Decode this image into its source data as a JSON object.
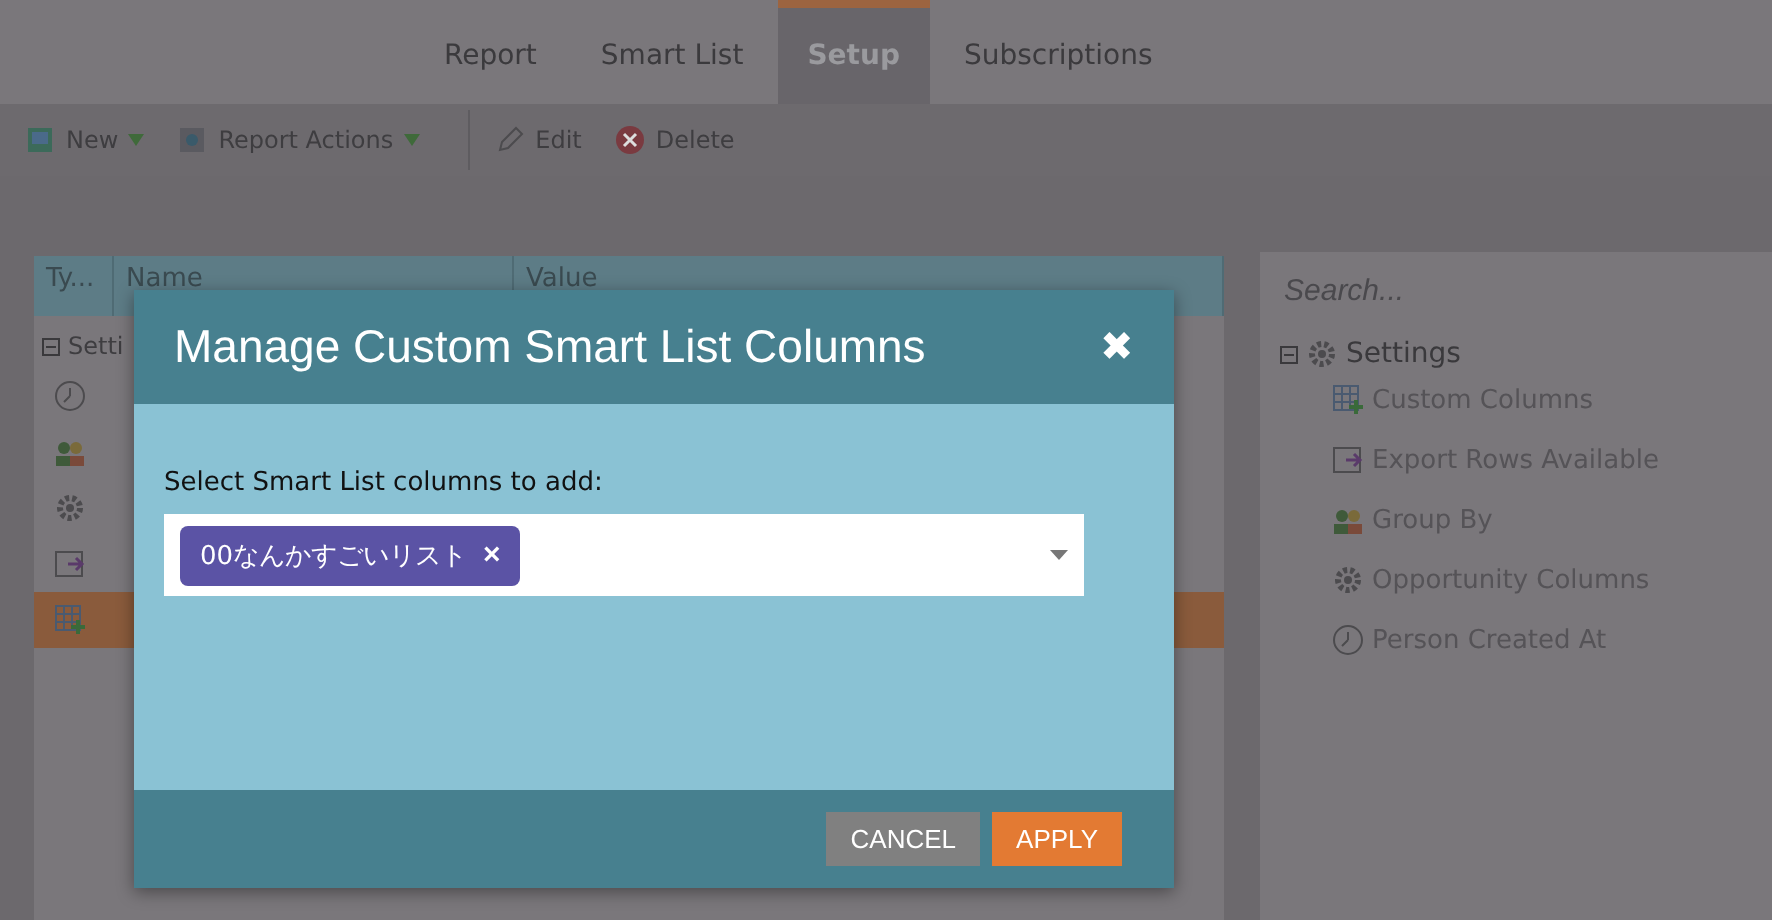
{
  "tabs": [
    {
      "label": "Report",
      "selected": false
    },
    {
      "label": "Smart List",
      "selected": false
    },
    {
      "label": "Setup",
      "selected": true
    },
    {
      "label": "Subscriptions",
      "selected": false
    }
  ],
  "toolbar": [
    {
      "label": "New",
      "kind": "new",
      "dropdown": true
    },
    {
      "label": "Report Actions",
      "kind": "report",
      "dropdown": true
    },
    {
      "label": "Edit",
      "kind": "edit",
      "dropdown": false
    },
    {
      "label": "Delete",
      "kind": "delete",
      "dropdown": false
    }
  ],
  "grid": {
    "columns": [
      "Ty...",
      "Name",
      "Value"
    ],
    "group": {
      "label": "Setti",
      "expanded": true
    },
    "rows": [
      {
        "kind": "clock",
        "selected": false
      },
      {
        "kind": "people",
        "selected": false
      },
      {
        "kind": "gear",
        "selected": false
      },
      {
        "kind": "export",
        "selected": false
      },
      {
        "kind": "columns",
        "selected": true
      }
    ]
  },
  "side_panel": {
    "search": {
      "placeholder": "Search..."
    },
    "tree": [
      {
        "label": "Settings",
        "kind": "gear",
        "expanded": true,
        "children": [
          {
            "label": "Custom Columns",
            "kind": "columns"
          },
          {
            "label": "Export Rows Available",
            "kind": "export"
          },
          {
            "label": "Group By",
            "kind": "people"
          },
          {
            "label": "Opportunity Columns",
            "kind": "gear"
          },
          {
            "label": "Person Created At",
            "kind": "clock"
          }
        ]
      }
    ]
  },
  "dialog": {
    "title": "Manage Custom Smart List Columns",
    "close": "✖",
    "field_label": "Select Smart List columns to add:",
    "tags": [
      {
        "label": "00なんかすごいリスト",
        "remove": "×"
      }
    ],
    "buttons": [
      {
        "label": "CANCEL",
        "kind": "secondary"
      },
      {
        "label": "APPLY",
        "kind": "primary"
      }
    ]
  }
}
